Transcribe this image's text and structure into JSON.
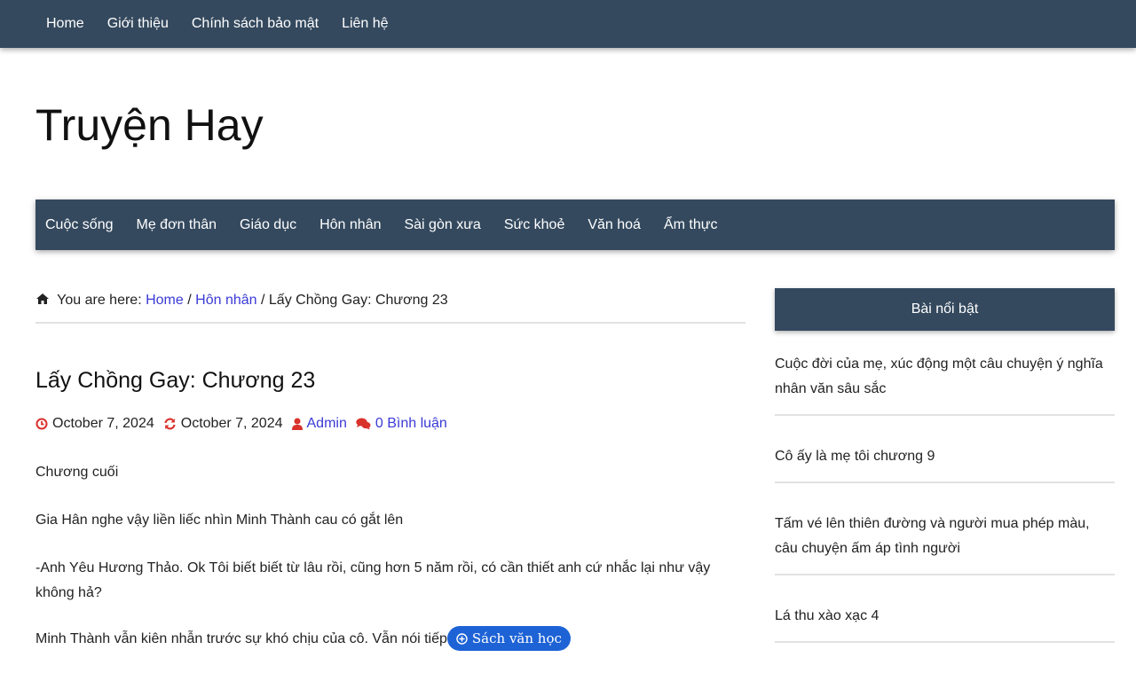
{
  "top_nav": [
    "Home",
    "Giới thiệu",
    "Chính sách bảo mật",
    "Liên hệ"
  ],
  "site_title": "Truyện Hay",
  "categories": [
    "Cuộc sống",
    "Mẹ đơn thân",
    "Giáo dục",
    "Hôn nhân",
    "Sài gòn xưa",
    "Sức khoẻ",
    "Văn hoá",
    "Ẩm thực"
  ],
  "breadcrumb": {
    "prefix": "You are here:",
    "home": "Home",
    "sep1": "/",
    "category": "Hôn nhân",
    "sep2": "/",
    "current": "Lấy Chồng Gay: Chương 23"
  },
  "post": {
    "title": "Lấy Chồng Gay: Chương 23",
    "published": "October 7, 2024",
    "updated": "October 7, 2024",
    "author": "Admin",
    "comments": "0 Bình luận",
    "paragraphs": [
      "Chương cuối",
      "Gia Hân nghe vậy liền liếc nhìn Minh Thành cau có gắt lên",
      "-Anh Yêu Hương Thảo. Ok Tôi biết biết từ lâu rồi, cũng hơn 5 năm rồi, có cần thiết anh cứ nhắc lại như vậy không hả?",
      "Minh Thành vẫn kiên nhẫn trước sự khó chịu của cô. Vẫn nói tiếp"
    ],
    "pill_label": "Sách văn học"
  },
  "sidebar": {
    "title": "Bài nổi bật",
    "items": [
      "Cuộc đời của mẹ, xúc động một câu chuyện ý nghĩa nhân văn sâu sắc",
      "Cô ấy là mẹ tôi chương 9",
      "Tấm vé lên thiên đường và người mua phép màu, câu chuyện ấm áp tình người",
      "Lá thu xào xạc 4"
    ]
  },
  "colors": {
    "nav_bg": "#34495e",
    "link": "#3a3ad6",
    "meta_icon": "#d9322b",
    "pill_bg": "#1e63d6"
  }
}
